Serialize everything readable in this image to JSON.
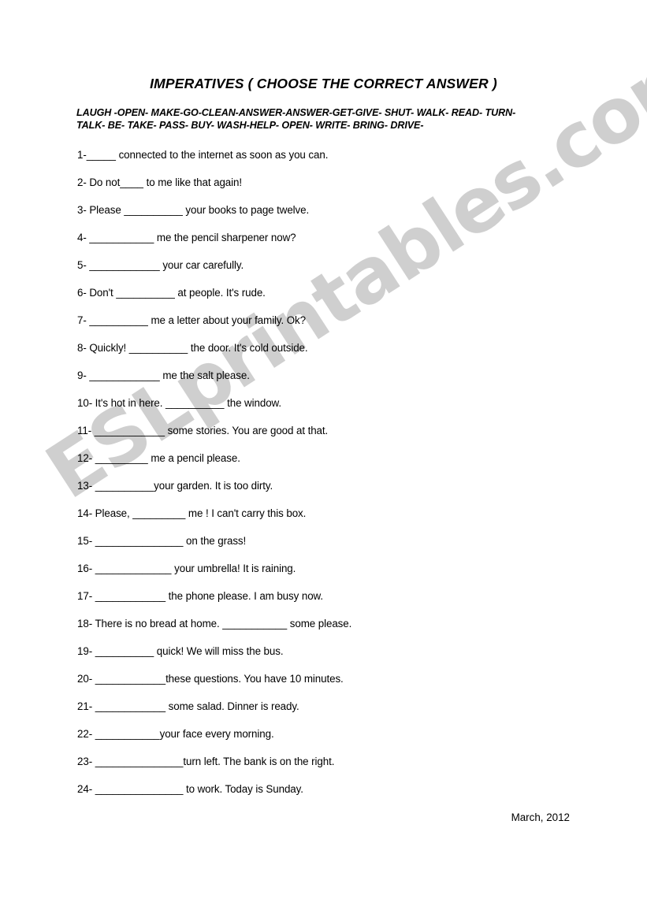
{
  "document": {
    "title": "IMPERATIVES ( CHOOSE THE CORRECT ANSWER )",
    "wordbank": {
      "line1": "LAUGH -OPEN- MAKE-GO-CLEAN-ANSWER-ANSWER-GET-GIVE- SHUT- WALK- READ- TURN-",
      "line2": "TALK- BE- TAKE- PASS- BUY- WASH-HELP- OPEN- WRITE- BRING- DRIVE-"
    },
    "footer_date": "March, 2012",
    "questions": [
      {
        "number": "1-",
        "before": "",
        "blank": "_____",
        "after": " connected to the internet as soon as you can."
      },
      {
        "number": "2-",
        "before": " Do not",
        "blank": "____",
        "after": " to me like that again!"
      },
      {
        "number": "3-",
        "before": " Please ",
        "blank": "__________",
        "after": " your books to page twelve."
      },
      {
        "number": "4-",
        "before": " ",
        "blank": "___________",
        "after": " me the pencil sharpener now?"
      },
      {
        "number": "5-",
        "before": " ",
        "blank": "____________",
        "after": " your car carefully."
      },
      {
        "number": "6-",
        "before": " Don't ",
        "blank": "__________",
        "after": " at people. It's rude."
      },
      {
        "number": "7-",
        "before": " ",
        "blank": "__________",
        "after": " me a letter about your family. Ok?"
      },
      {
        "number": "8-",
        "before": " Quickly! ",
        "blank": "__________",
        "after": " the door. It's cold outside."
      },
      {
        "number": "9-",
        "before": " ",
        "blank": "____________",
        "after": " me the salt please."
      },
      {
        "number": "10-",
        "before": " It's hot in here. ",
        "blank": "__________",
        "after": " the window."
      },
      {
        "number": "11-",
        "before": " ",
        "blank": "____________",
        "after": " some stories. You are good at that."
      },
      {
        "number": "12-",
        "before": " ",
        "blank": "_________",
        "after": " me a pencil please."
      },
      {
        "number": "13-",
        "before": " ",
        "blank": "__________",
        "after": "your garden. It is too dirty."
      },
      {
        "number": "14-",
        "before": " Please, ",
        "blank": "_________",
        "after": " me ! I can't carry this box."
      },
      {
        "number": "15-",
        "before": " ",
        "blank": "_______________",
        "after": " on the grass!"
      },
      {
        "number": "16-",
        "before": " ",
        "blank": "_____________",
        "after": " your umbrella! It is raining."
      },
      {
        "number": "17-",
        "before": " ",
        "blank": "____________",
        "after": " the phone please. I am busy now."
      },
      {
        "number": "18-",
        "before": " There is no bread at home. ",
        "blank": "___________",
        "after": " some please."
      },
      {
        "number": "19-",
        "before": " ",
        "blank": "__________",
        "after": " quick! We will miss the bus."
      },
      {
        "number": "20-",
        "before": " ",
        "blank": "____________",
        "after": "these questions. You have 10 minutes."
      },
      {
        "number": "21-",
        "before": " ",
        "blank": "____________",
        "after": " some salad. Dinner is ready."
      },
      {
        "number": "22-",
        "before": " ",
        "blank": "___________",
        "after": "your face every morning."
      },
      {
        "number": "23-",
        "before": " ",
        "blank": "_______________",
        "after": "turn left. The bank is on the right."
      },
      {
        "number": "24-",
        "before": " ",
        "blank": "_______________",
        "after": " to work. Today is Sunday."
      }
    ]
  },
  "watermark": {
    "text": "ESLprintables.com",
    "color": "#cfcfcf"
  }
}
